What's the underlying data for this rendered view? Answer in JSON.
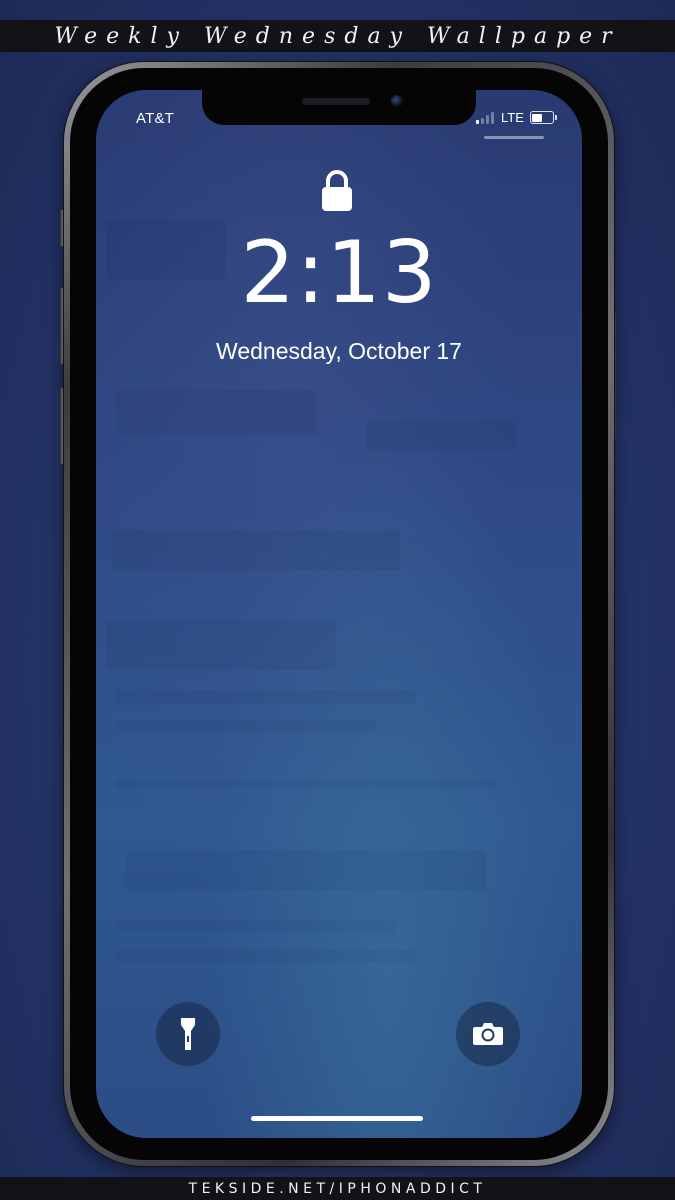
{
  "header": {
    "title": "Weekly Wednesday Wallpaper"
  },
  "footer": {
    "credit": "TEKSIDE.NET/IPHONADDICT"
  },
  "status_bar": {
    "carrier": "AT&T",
    "network": "LTE",
    "signal_bars_active": 1,
    "signal_bars_total": 4,
    "battery_level": 0.6
  },
  "lock_screen": {
    "lock_icon": "lock-icon",
    "time": "2:13",
    "date": "Wednesday, October 17"
  },
  "quick_actions": {
    "left_icon": "flashlight-icon",
    "right_icon": "camera-icon"
  },
  "colors": {
    "background": "#26366a",
    "screen_top": "#2a3a72",
    "screen_bottom": "#2c4d86",
    "text": "#ffffff",
    "caption_bar": "#121318"
  }
}
